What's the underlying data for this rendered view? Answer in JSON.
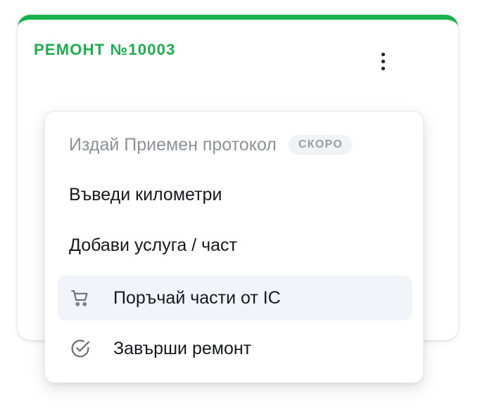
{
  "card": {
    "title": "РЕМОНТ №10003",
    "accent_color": "#19b04b"
  },
  "menu": {
    "items": [
      {
        "label": "Издай Приемен протокол",
        "badge": "СКОРО",
        "disabled": true
      },
      {
        "label": "Въведи километри"
      },
      {
        "label": "Добави услуга / част"
      },
      {
        "label": "Поръчай части от IC",
        "icon": "cart-icon",
        "hovered": true
      },
      {
        "label": "Завърши ремонт",
        "icon": "check-circle-icon"
      }
    ]
  }
}
